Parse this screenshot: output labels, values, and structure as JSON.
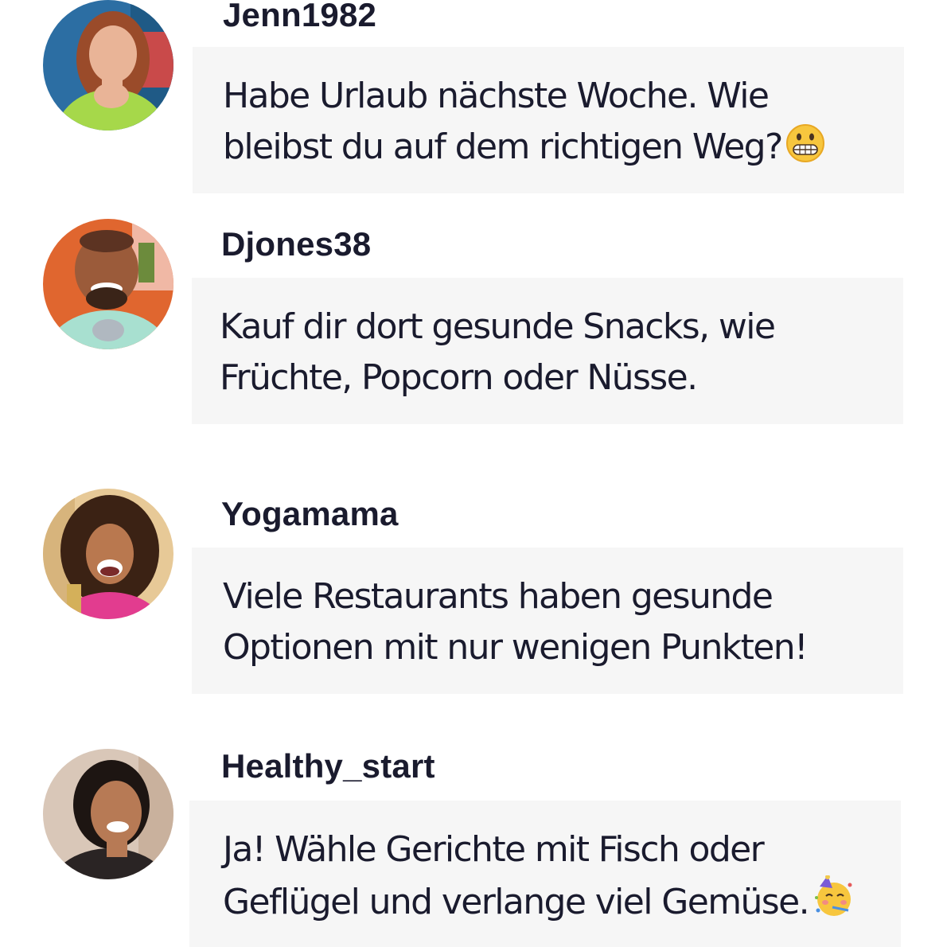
{
  "comments": [
    {
      "username": "Jenn1982",
      "message": "Habe Urlaub nächste Woche. Wie\nbleibst du auf dem richtigen Weg?",
      "emoji": "grimacing-face",
      "avatar": {
        "background": "#2c6ea3",
        "skin": "#e9b497",
        "hair": "#9a4b2a",
        "shirt": "#a6d84a"
      }
    },
    {
      "username": "Djones38",
      "message": "Kauf dir dort gesunde Snacks, wie\nFrüchte, Popcorn oder Nüsse.",
      "emoji": "",
      "avatar": {
        "background": "#e0662f",
        "skin": "#9b5b3a",
        "hair": "#3a2418",
        "shirt": "#a8e0d0"
      }
    },
    {
      "username": "Yogamama",
      "message": "Viele Restaurants haben gesunde\nOptionen mit nur wenigen Punkten!",
      "emoji": "",
      "avatar": {
        "background": "#e7c997",
        "skin": "#b9784f",
        "hair": "#3b2214",
        "shirt": "#e23c8f"
      }
    },
    {
      "username": "Healthy_start",
      "message": "Ja! Wähle Gerichte mit Fisch oder\nGeflügel und verlange viel Gemüse.",
      "emoji": "partying-face",
      "avatar": {
        "background": "#d9c7b8",
        "skin": "#b77a55",
        "hair": "#1d1512",
        "shirt": "#2a2424"
      }
    }
  ]
}
